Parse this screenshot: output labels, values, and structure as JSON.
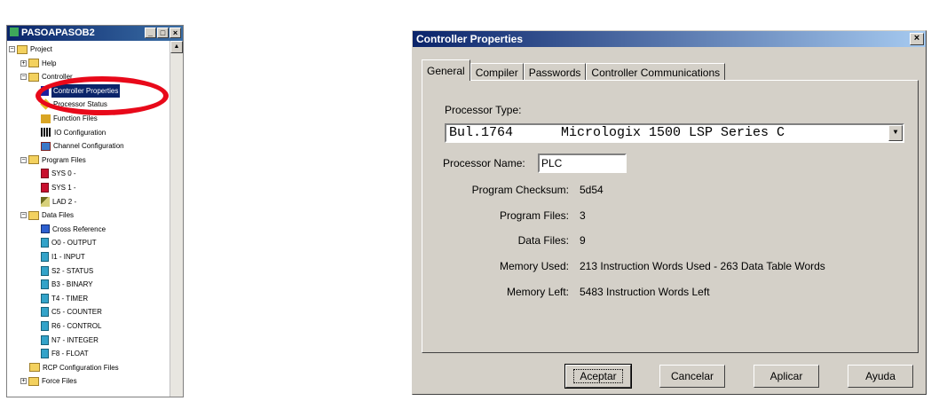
{
  "tree_window": {
    "title": "PASOAPASOB2",
    "min": "_",
    "max": "□",
    "close": "×",
    "nodes": [
      {
        "label": "Project",
        "icon": "folder-icon",
        "toggle": "−"
      },
      {
        "label": "Help",
        "icon": "folder-icon",
        "toggle": "+"
      },
      {
        "label": "Controller",
        "icon": "folder-icon",
        "toggle": "−"
      },
      {
        "label": "Controller Properties",
        "icon": "controller-properties-icon"
      },
      {
        "label": "Processor Status",
        "icon": "processor-status-icon"
      },
      {
        "label": "Function Files",
        "icon": "function-files-icon"
      },
      {
        "label": "IO Configuration",
        "icon": "io-configuration-icon"
      },
      {
        "label": "Channel Configuration",
        "icon": "channel-configuration-icon"
      },
      {
        "label": "Program Files",
        "icon": "folder-icon",
        "toggle": "−"
      },
      {
        "label": "SYS 0 -",
        "icon": "system-file-icon"
      },
      {
        "label": "SYS 1 -",
        "icon": "system-file-icon"
      },
      {
        "label": "LAD 2 -",
        "icon": "ladder-file-icon"
      },
      {
        "label": "Data Files",
        "icon": "folder-icon",
        "toggle": "−"
      },
      {
        "label": "Cross Reference",
        "icon": "cross-reference-icon"
      },
      {
        "label": "O0 - OUTPUT",
        "icon": "data-file-icon"
      },
      {
        "label": "I1 - INPUT",
        "icon": "data-file-icon"
      },
      {
        "label": "S2 - STATUS",
        "icon": "data-file-icon"
      },
      {
        "label": "B3 - BINARY",
        "icon": "data-file-icon"
      },
      {
        "label": "T4 - TIMER",
        "icon": "data-file-icon"
      },
      {
        "label": "C5 - COUNTER",
        "icon": "data-file-icon"
      },
      {
        "label": "R6 - CONTROL",
        "icon": "data-file-icon"
      },
      {
        "label": "N7 - INTEGER",
        "icon": "data-file-icon"
      },
      {
        "label": "F8 - FLOAT",
        "icon": "data-file-icon"
      },
      {
        "label": "RCP Configuration Files",
        "icon": "folder-icon"
      },
      {
        "label": "Force Files",
        "icon": "folder-icon",
        "toggle": "+"
      }
    ]
  },
  "dialog": {
    "title": "Controller Properties",
    "close": "×",
    "tabs": [
      "General",
      "Compiler",
      "Passwords",
      "Controller Communications"
    ],
    "active_tab": "General",
    "processor_type_label": "Processor Type:",
    "processor_type_value": "Bul.1764      Micrologix 1500 LSP Series C",
    "processor_name_label": "Processor Name:",
    "processor_name_value": "PLC",
    "fields": [
      {
        "label": "Program Checksum:",
        "value": "5d54"
      },
      {
        "label": "Program Files:",
        "value": "3"
      },
      {
        "label": "Data Files:",
        "value": "9"
      },
      {
        "label": "Memory Used:",
        "value": "213 Instruction Words Used - 263 Data Table Words"
      },
      {
        "label": "Memory Left:",
        "value": "5483 Instruction Words Left"
      }
    ],
    "buttons": {
      "accept": "Aceptar",
      "cancel": "Cancelar",
      "apply": "Aplicar",
      "help": "Ayuda"
    }
  },
  "colors": {
    "title_bar": "#0a246a",
    "dialog_face": "#d4d0c8",
    "highlight_ellipse": "#e8091a"
  }
}
